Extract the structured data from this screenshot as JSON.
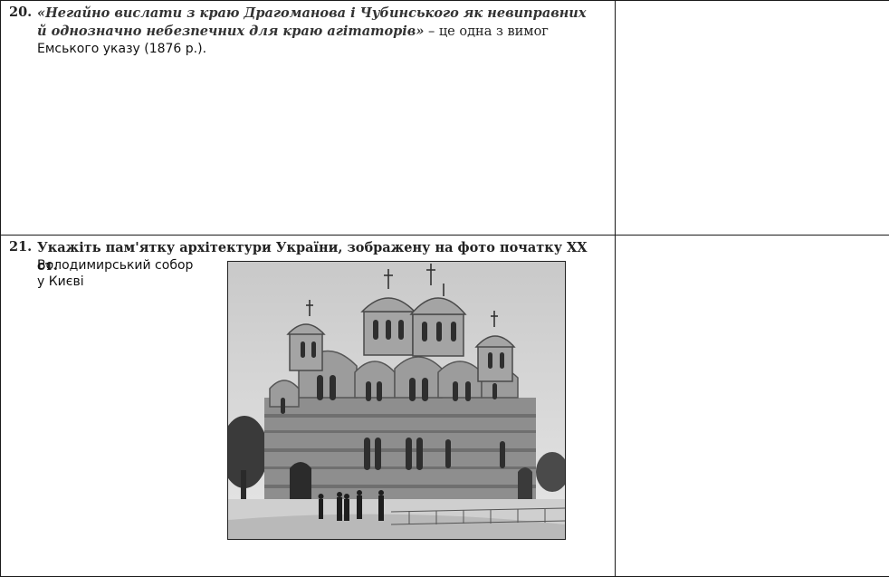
{
  "q20": {
    "number": "20.",
    "quote": "«Негайно вислати з краю Драгоманова і Чубинського як невиправних й однозначно небезпечних для краю агітаторів»",
    "question_tail": "– це одна з вимог",
    "answer": "Емського указу (1876 р.)."
  },
  "q21": {
    "number": "21.",
    "question": "Укажіть пам'ятку архітектури України, зображену на фото початку XX ст.",
    "answer_line1": "Володимирський собор",
    "answer_line2": "у Києві",
    "photo": {
      "subject": "cathedral-photo"
    }
  }
}
